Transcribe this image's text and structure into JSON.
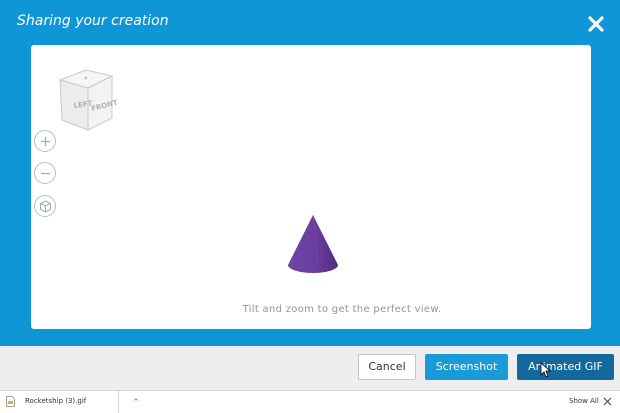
{
  "dialog": {
    "title": "Sharing your creation",
    "close_icon": "close-icon"
  },
  "viewport": {
    "viewcube": {
      "left_face": "LEFT",
      "front_face": "FRONT"
    },
    "controls": [
      {
        "name": "zoom-in",
        "icon": "plus-icon"
      },
      {
        "name": "zoom-out",
        "icon": "minus-icon"
      },
      {
        "name": "home-view",
        "icon": "cube-icon"
      }
    ],
    "model_color": "#6b3fa0",
    "hint": "Tilt and zoom to get the perfect view."
  },
  "footer": {
    "cancel_label": "Cancel",
    "screenshot_label": "Screenshot",
    "gif_label": "Animated GIF"
  },
  "downloads": {
    "file_name": "Rocketship (3).gif",
    "show_all_label": "Show All"
  },
  "colors": {
    "dialog_bg": "#0f96d6",
    "screenshot_button": "#1a9ad6",
    "gif_button": "#13689d"
  }
}
